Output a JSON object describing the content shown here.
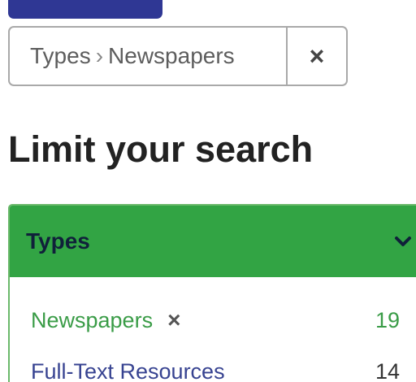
{
  "applied_filter": {
    "category": "Types",
    "separator": "›",
    "value": "Newspapers",
    "remove_label": "×"
  },
  "heading": {
    "title": "Limit your search"
  },
  "facet": {
    "title": "Types",
    "items": [
      {
        "label": "Newspapers",
        "remove_label": "×",
        "count": "19",
        "selected": true
      },
      {
        "label": "Full-Text Resources",
        "count": "14",
        "selected": false
      }
    ]
  },
  "colors": {
    "top_button": "#2f3794",
    "facet_header": "#32a444",
    "selected_text": "#3a9c47",
    "link_text": "#374391"
  },
  "icons": {
    "remove": "close-icon",
    "expand": "chevron-down-icon"
  }
}
